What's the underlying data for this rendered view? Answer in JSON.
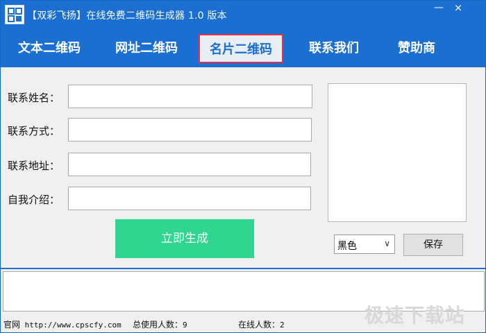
{
  "titlebar": {
    "title": "【双彩飞扬】在线免费二维码生成器 1.0 版本",
    "minimize": "—",
    "close": "×"
  },
  "tabs": [
    {
      "label": "文本二维码",
      "active": false
    },
    {
      "label": "网址二维码",
      "active": false
    },
    {
      "label": "名片二维码",
      "active": true
    },
    {
      "label": "联系我们",
      "active": false
    },
    {
      "label": "赞助商",
      "active": false
    }
  ],
  "form": {
    "fields": [
      {
        "label": "联系姓名：",
        "value": ""
      },
      {
        "label": "联系方式：",
        "value": ""
      },
      {
        "label": "联系地址：",
        "value": ""
      },
      {
        "label": "自我介绍：",
        "value": ""
      }
    ],
    "generate_label": "立即生成"
  },
  "preview": {
    "color_selected": "黑色",
    "save_label": "保存"
  },
  "statusbar": {
    "site_label": "官网",
    "site_url": "http://www.cpscfy.com",
    "total_users_label": "总使用人数：",
    "total_users": "9",
    "online_users_label": "在线人数：",
    "online_users": "2"
  },
  "watermark": "极速下载站",
  "colors": {
    "brand_blue": "#1a6fd1",
    "generate_green": "#2fd690",
    "active_tab_border": "#e2324b"
  }
}
